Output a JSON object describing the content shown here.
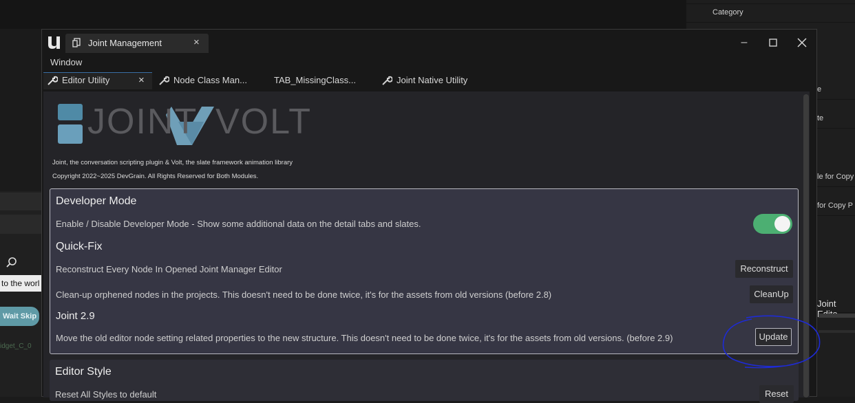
{
  "background": {
    "right_panel": {
      "category_label": "Category",
      "fragments": [
        "e",
        "te",
        "le for Copy",
        "for Copy P",
        "Joint Edito"
      ]
    },
    "left_panel": {
      "text_fragment": "to the worl",
      "button_label": "Wait Skip",
      "bottom_fragment": "idget_C_0"
    }
  },
  "window": {
    "title": "Joint Management",
    "menu": [
      "Window"
    ],
    "tabs": [
      {
        "label": "Editor Utility",
        "active": true
      },
      {
        "label": "Node Class Man..."
      },
      {
        "label": "TAB_MissingClass..."
      },
      {
        "label": "Joint Native Utility"
      }
    ]
  },
  "header": {
    "logo_text_1": "JOINT",
    "logo_text_2": "VOLT",
    "description": "Joint, the conversation scripting plugin & Volt, the slate framework animation library",
    "copyright": "Copyright 2022~2025 DevGrain. All Rights Reserved for Both Modules."
  },
  "sections": {
    "developer_mode": {
      "title": "Developer Mode",
      "desc": "Enable / Disable Developer Mode - Show some additional data on the detail tabs and slates.",
      "toggle_on": true
    },
    "quick_fix": {
      "title": "Quick-Fix",
      "reconstruct_desc": "Reconstruct Every Node In Opened Joint Manager Editor",
      "reconstruct_btn": "Reconstruct",
      "cleanup_desc": "Clean-up orphened nodes in the projects. This doesn't need to be done twice, it's for the assets from old versions (before 2.8)",
      "cleanup_btn": "CleanUp"
    },
    "joint29": {
      "title": "Joint 2.9",
      "desc": "Move the old editor node setting related properties to the new structure. This doesn't need to be done twice, it's for the assets from old versions. (before 2.9)",
      "update_btn": "Update"
    },
    "editor_style": {
      "title": "Editor Style",
      "desc": "Reset All Styles to default",
      "reset_btn": "Reset"
    }
  },
  "colors": {
    "toggle": "#4caf72",
    "annotation": "#1e2bd6",
    "logo": "#6f9fb8"
  }
}
